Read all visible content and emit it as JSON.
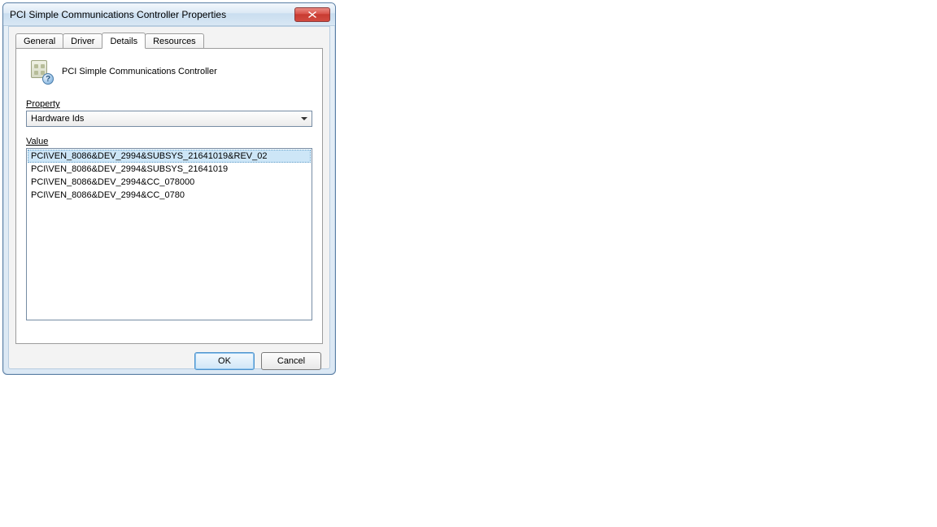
{
  "window": {
    "title": "PCI Simple Communications Controller Properties"
  },
  "tabs": [
    {
      "label": "General"
    },
    {
      "label": "Driver"
    },
    {
      "label": "Details"
    },
    {
      "label": "Resources"
    }
  ],
  "device": {
    "name": "PCI Simple Communications Controller"
  },
  "property_section": {
    "label": "Property",
    "selected": "Hardware Ids"
  },
  "value_section": {
    "label": "Value",
    "items": [
      "PCI\\VEN_8086&DEV_2994&SUBSYS_21641019&REV_02",
      "PCI\\VEN_8086&DEV_2994&SUBSYS_21641019",
      "PCI\\VEN_8086&DEV_2994&CC_078000",
      "PCI\\VEN_8086&DEV_2994&CC_0780"
    ]
  },
  "buttons": {
    "ok": "OK",
    "cancel": "Cancel"
  }
}
